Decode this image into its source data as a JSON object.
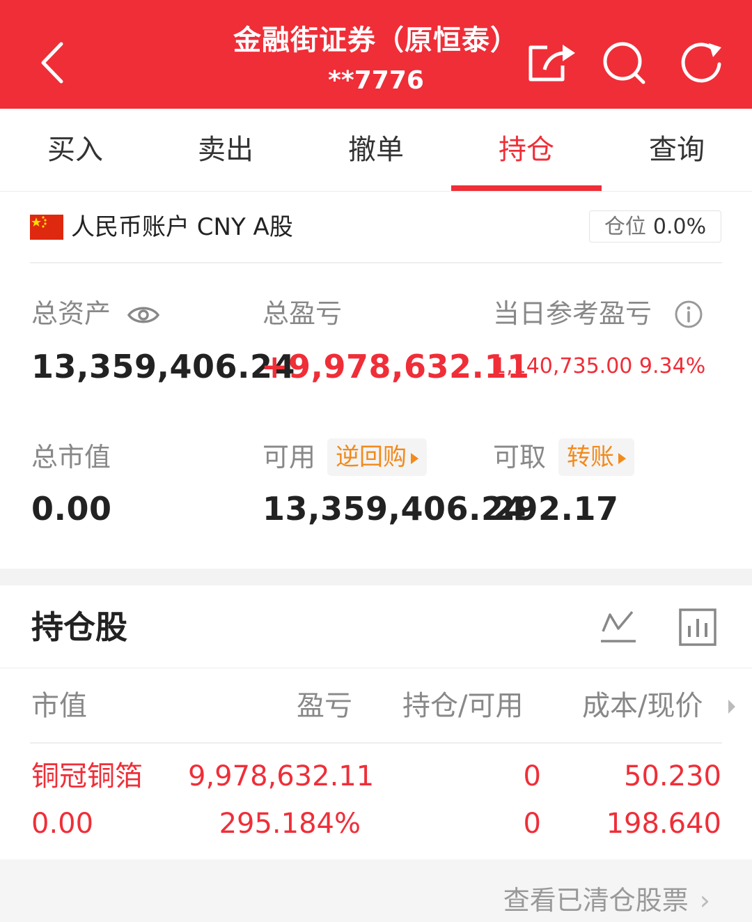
{
  "header": {
    "title": "金融街证券（原恒泰）",
    "account_masked": "**7776",
    "background_color": "#ef2e38",
    "icons": [
      "back-icon",
      "share-icon",
      "search-icon",
      "refresh-icon"
    ]
  },
  "tabs": [
    {
      "label": "买入",
      "active": false
    },
    {
      "label": "卖出",
      "active": false
    },
    {
      "label": "撤单",
      "active": false
    },
    {
      "label": "持仓",
      "active": true
    },
    {
      "label": "查询",
      "active": false
    }
  ],
  "account": {
    "label": "人民币账户 CNY A股",
    "position_label": "仓位",
    "position_value": "0.0%"
  },
  "assets": {
    "total_assets_label": "总资产",
    "total_assets_value": "13,359,406.24",
    "total_pl_label": "总盈亏",
    "total_pl_value": "+9,978,632.11",
    "daily_pl_label": "当日参考盈亏",
    "daily_pl_value": "1,140,735.00 9.34%",
    "market_value_label": "总市值",
    "market_value_value": "0.00",
    "available_label": "可用",
    "reverse_repo_label": "逆回购",
    "available_value": "13,359,406.24",
    "withdrawable_label": "可取",
    "transfer_label": "转账",
    "withdrawable_value": "292.17"
  },
  "holdings": {
    "title": "持仓股",
    "columns": [
      "市值",
      "盈亏",
      "持仓/可用",
      "成本/现价"
    ],
    "rows": [
      {
        "name": "铜冠铜箔",
        "market_value": "0.00",
        "pl_amount": "9,978,632.11",
        "pl_percent": "295.184%",
        "holding": "0",
        "available": "0",
        "cost": "50.230",
        "price": "198.640"
      }
    ],
    "view_cleared_label": "查看已清仓股票"
  },
  "colors": {
    "accent_red": "#ef2e38",
    "accent_orange": "#f28a1c",
    "label_gray": "#888888"
  }
}
